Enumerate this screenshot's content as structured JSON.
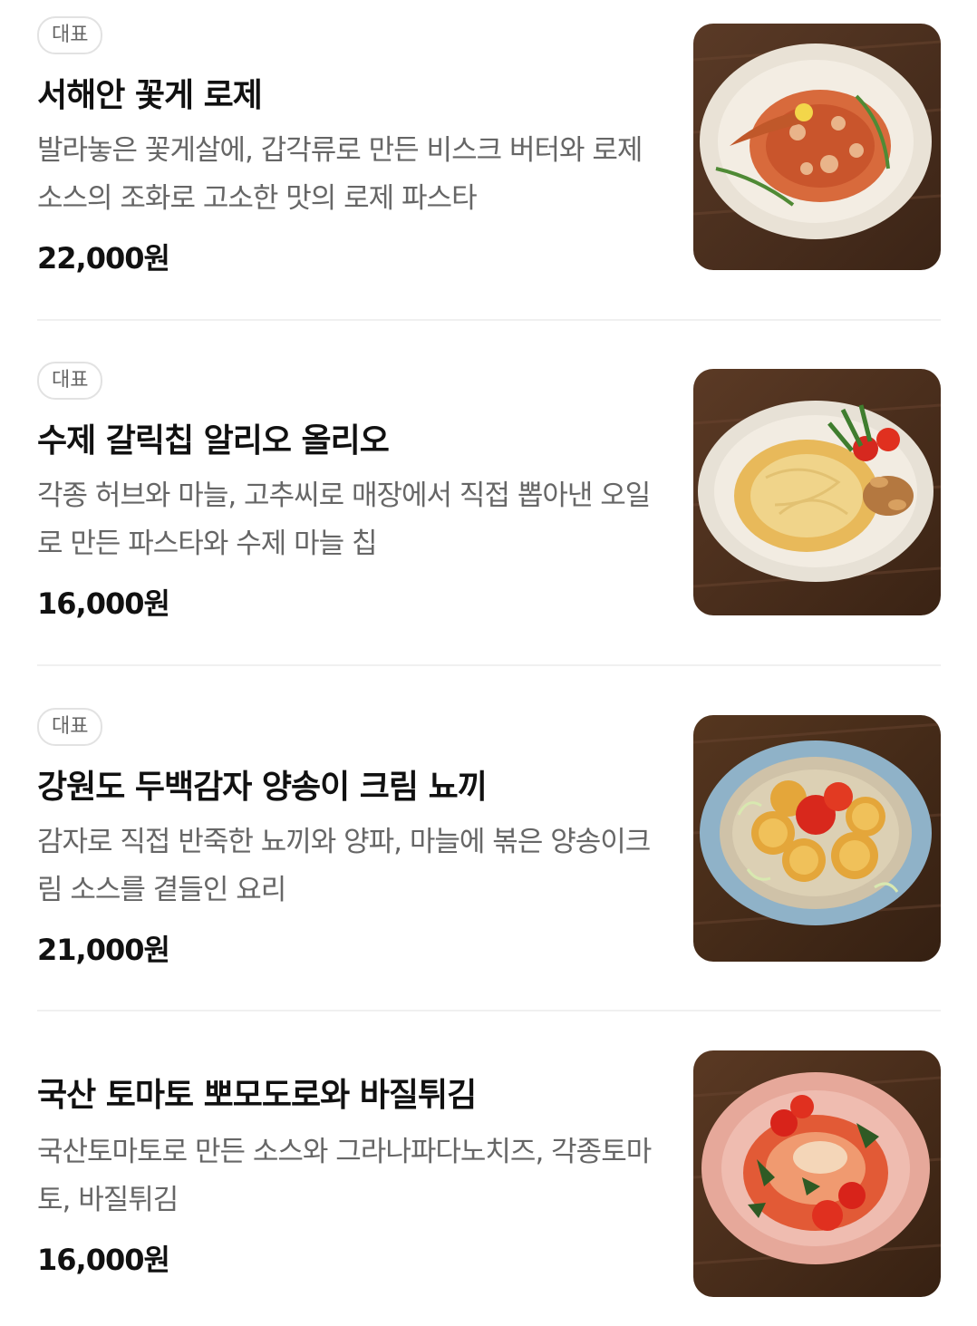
{
  "menu": {
    "items": [
      {
        "badge": "대표",
        "name": "서해안 꽃게 로제",
        "description": "발라놓은 꽃게살에, 갑각류로 만든 비스크 버터와 로제소스의 조화로 고소한 맛의 로제 파스타",
        "price": "22,000원",
        "image_alt": "rose-pasta-with-crab"
      },
      {
        "badge": "대표",
        "name": "수제 갈릭칩 알리오 올리오",
        "description": "각종 허브와 마늘, 고추씨로 매장에서 직접 뽑아낸 오일로 만든 파스타와 수제 마늘 칩",
        "price": "16,000원",
        "image_alt": "aglio-olio-pasta"
      },
      {
        "badge": "대표",
        "name": "강원도 두백감자 양송이 크림 뇨끼",
        "description": "감자로 직접 반죽한 뇨끼와 양파, 마늘에 볶은 양송이크림 소스를 곁들인 요리",
        "price": "21,000원",
        "image_alt": "potato-gnocchi-cream"
      },
      {
        "name": "국산 토마토 뽀모도로와 바질튀김",
        "description": "국산토마토로 만든 소스와 그라나파다노치즈, 각종토마토, 바질튀김",
        "price": "16,000원",
        "image_alt": "tomato-pomodoro-pasta"
      }
    ]
  }
}
